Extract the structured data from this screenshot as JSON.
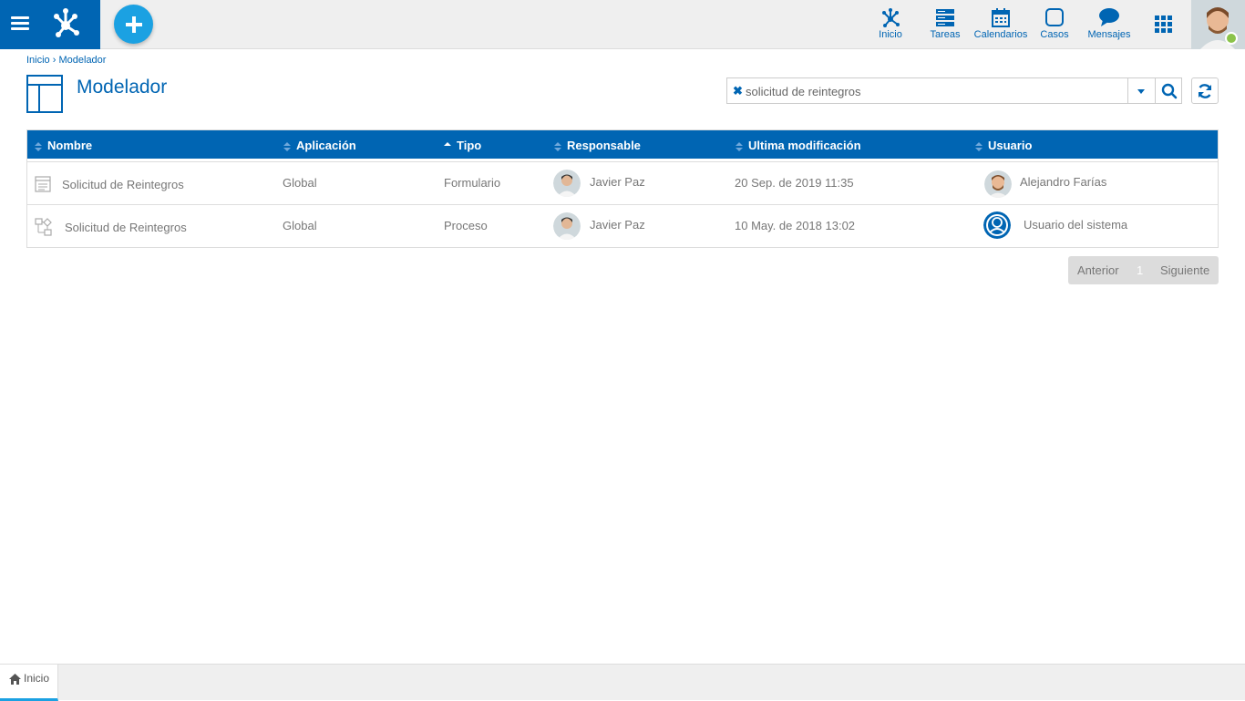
{
  "nav": {
    "items": [
      {
        "label": "Inicio",
        "icon": "process-network-icon"
      },
      {
        "label": "Tareas",
        "icon": "tasks-icon"
      },
      {
        "label": "Calendarios",
        "icon": "calendar-icon"
      },
      {
        "label": "Casos",
        "icon": "cases-icon"
      },
      {
        "label": "Mensajes",
        "icon": "message-icon"
      }
    ]
  },
  "breadcrumb": {
    "home": "Inicio",
    "separator": "›",
    "current": "Modelador"
  },
  "page": {
    "title": "Modelador"
  },
  "search": {
    "value": "solicitud de reintegros"
  },
  "table": {
    "columns": [
      "Nombre",
      "Aplicación",
      "Tipo",
      "Responsable",
      "Ultima modificación",
      "Usuario"
    ],
    "sorted_column": "Tipo",
    "rows": [
      {
        "nombre": "Solicitud de Reintegros",
        "aplicacion": "Global",
        "tipo": "Formulario",
        "responsable": "Javier Paz",
        "modificacion": "20 Sep. de 2019 11:35",
        "usuario": "Alejandro Farías",
        "icon": "form-icon"
      },
      {
        "nombre": "Solicitud de Reintegros",
        "aplicacion": "Global",
        "tipo": "Proceso",
        "responsable": "Javier Paz",
        "modificacion": "10 May. de 2018 13:02",
        "usuario": "Usuario del sistema",
        "icon": "process-icon"
      }
    ]
  },
  "pager": {
    "prev": "Anterior",
    "page": "1",
    "next": "Siguiente"
  },
  "bottom_tabs": {
    "home": "Inicio"
  },
  "colors": {
    "primary": "#0065b3",
    "accent": "#1ba1e2",
    "online": "#8bc34a"
  }
}
